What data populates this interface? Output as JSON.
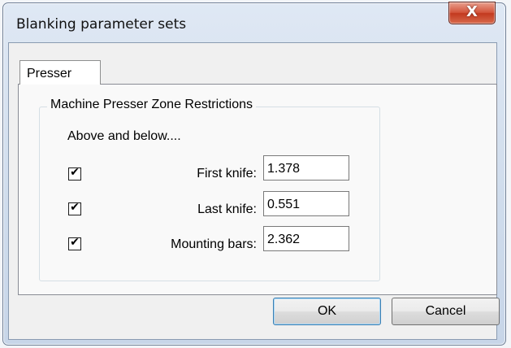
{
  "window": {
    "title": "Blanking parameter sets",
    "close_icon": "close-icon",
    "close_glyph": "X"
  },
  "tabs": [
    {
      "label": "Presser",
      "selected": true
    }
  ],
  "group": {
    "legend": "Machine Presser Zone Restrictions",
    "subheading": "Above and below....",
    "rows": [
      {
        "label": "First knife:",
        "checked": true,
        "value": "1.378"
      },
      {
        "label": "Last knife:",
        "checked": true,
        "value": "0.551"
      },
      {
        "label": "Mounting bars:",
        "checked": true,
        "value": "2.362"
      }
    ],
    "check_glyph": "✔"
  },
  "buttons": {
    "ok": "OK",
    "cancel": "Cancel"
  }
}
